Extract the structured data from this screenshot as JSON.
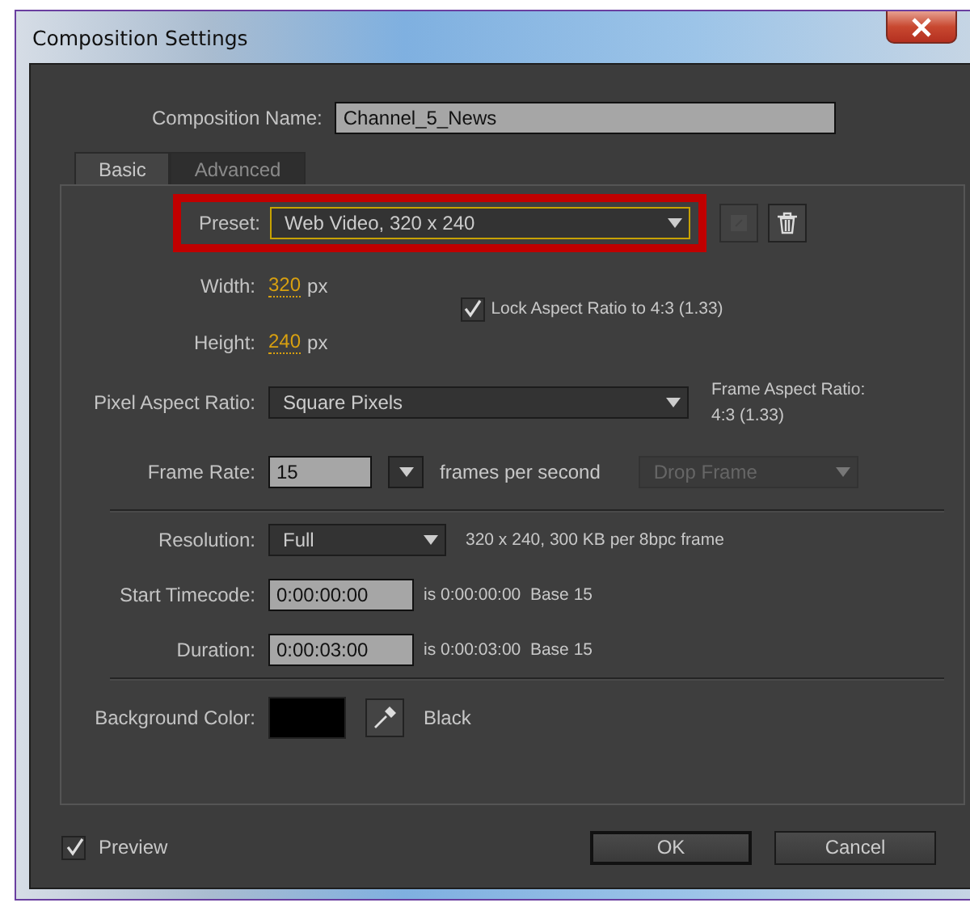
{
  "window": {
    "title": "Composition Settings"
  },
  "composition_name": {
    "label": "Composition Name:",
    "value": "Channel_5_News"
  },
  "tabs": [
    {
      "label": "Basic",
      "selected": true
    },
    {
      "label": "Advanced",
      "selected": false
    }
  ],
  "preset": {
    "label": "Preset:",
    "value": "Web Video, 320 x 240",
    "highlighted": true
  },
  "width": {
    "label": "Width:",
    "value": "320",
    "unit": "px"
  },
  "height": {
    "label": "Height:",
    "value": "240",
    "unit": "px"
  },
  "lock_aspect": {
    "label": "Lock Aspect Ratio to 4:3 (1.33)",
    "checked": true
  },
  "pixel_aspect_ratio": {
    "label": "Pixel Aspect Ratio:",
    "value": "Square Pixels"
  },
  "frame_aspect": {
    "label": "Frame Aspect Ratio:",
    "value": "4:3 (1.33)"
  },
  "frame_rate": {
    "label": "Frame Rate:",
    "value": "15",
    "unit": "frames per second",
    "drop_frame": {
      "value": "Drop Frame",
      "disabled": true
    }
  },
  "resolution": {
    "label": "Resolution:",
    "value": "Full",
    "info": "320 x 240, 300 KB per 8bpc frame"
  },
  "start_timecode": {
    "label": "Start Timecode:",
    "value": "0:00:00:00",
    "info": "is 0:00:00:00  Base 15"
  },
  "duration": {
    "label": "Duration:",
    "value": "0:00:03:00",
    "info": "is 0:00:03:00  Base 15"
  },
  "background_color": {
    "label": "Background Color:",
    "color": "#000000",
    "name": "Black"
  },
  "preview": {
    "label": "Preview",
    "checked": true
  },
  "buttons": [
    {
      "label": "OK",
      "default": true
    },
    {
      "label": "Cancel",
      "default": false
    }
  ]
}
